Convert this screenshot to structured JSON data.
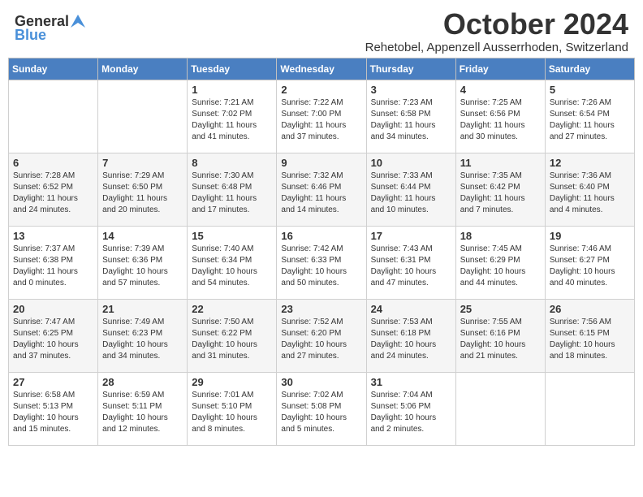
{
  "header": {
    "logo_general": "General",
    "logo_blue": "Blue",
    "month": "October 2024",
    "location": "Rehetobel, Appenzell Ausserrhoden, Switzerland"
  },
  "days_of_week": [
    "Sunday",
    "Monday",
    "Tuesday",
    "Wednesday",
    "Thursday",
    "Friday",
    "Saturday"
  ],
  "weeks": [
    [
      {
        "day": "",
        "sunrise": "",
        "sunset": "",
        "daylight": ""
      },
      {
        "day": "",
        "sunrise": "",
        "sunset": "",
        "daylight": ""
      },
      {
        "day": "1",
        "sunrise": "Sunrise: 7:21 AM",
        "sunset": "Sunset: 7:02 PM",
        "daylight": "Daylight: 11 hours and 41 minutes."
      },
      {
        "day": "2",
        "sunrise": "Sunrise: 7:22 AM",
        "sunset": "Sunset: 7:00 PM",
        "daylight": "Daylight: 11 hours and 37 minutes."
      },
      {
        "day": "3",
        "sunrise": "Sunrise: 7:23 AM",
        "sunset": "Sunset: 6:58 PM",
        "daylight": "Daylight: 11 hours and 34 minutes."
      },
      {
        "day": "4",
        "sunrise": "Sunrise: 7:25 AM",
        "sunset": "Sunset: 6:56 PM",
        "daylight": "Daylight: 11 hours and 30 minutes."
      },
      {
        "day": "5",
        "sunrise": "Sunrise: 7:26 AM",
        "sunset": "Sunset: 6:54 PM",
        "daylight": "Daylight: 11 hours and 27 minutes."
      }
    ],
    [
      {
        "day": "6",
        "sunrise": "Sunrise: 7:28 AM",
        "sunset": "Sunset: 6:52 PM",
        "daylight": "Daylight: 11 hours and 24 minutes."
      },
      {
        "day": "7",
        "sunrise": "Sunrise: 7:29 AM",
        "sunset": "Sunset: 6:50 PM",
        "daylight": "Daylight: 11 hours and 20 minutes."
      },
      {
        "day": "8",
        "sunrise": "Sunrise: 7:30 AM",
        "sunset": "Sunset: 6:48 PM",
        "daylight": "Daylight: 11 hours and 17 minutes."
      },
      {
        "day": "9",
        "sunrise": "Sunrise: 7:32 AM",
        "sunset": "Sunset: 6:46 PM",
        "daylight": "Daylight: 11 hours and 14 minutes."
      },
      {
        "day": "10",
        "sunrise": "Sunrise: 7:33 AM",
        "sunset": "Sunset: 6:44 PM",
        "daylight": "Daylight: 11 hours and 10 minutes."
      },
      {
        "day": "11",
        "sunrise": "Sunrise: 7:35 AM",
        "sunset": "Sunset: 6:42 PM",
        "daylight": "Daylight: 11 hours and 7 minutes."
      },
      {
        "day": "12",
        "sunrise": "Sunrise: 7:36 AM",
        "sunset": "Sunset: 6:40 PM",
        "daylight": "Daylight: 11 hours and 4 minutes."
      }
    ],
    [
      {
        "day": "13",
        "sunrise": "Sunrise: 7:37 AM",
        "sunset": "Sunset: 6:38 PM",
        "daylight": "Daylight: 11 hours and 0 minutes."
      },
      {
        "day": "14",
        "sunrise": "Sunrise: 7:39 AM",
        "sunset": "Sunset: 6:36 PM",
        "daylight": "Daylight: 10 hours and 57 minutes."
      },
      {
        "day": "15",
        "sunrise": "Sunrise: 7:40 AM",
        "sunset": "Sunset: 6:34 PM",
        "daylight": "Daylight: 10 hours and 54 minutes."
      },
      {
        "day": "16",
        "sunrise": "Sunrise: 7:42 AM",
        "sunset": "Sunset: 6:33 PM",
        "daylight": "Daylight: 10 hours and 50 minutes."
      },
      {
        "day": "17",
        "sunrise": "Sunrise: 7:43 AM",
        "sunset": "Sunset: 6:31 PM",
        "daylight": "Daylight: 10 hours and 47 minutes."
      },
      {
        "day": "18",
        "sunrise": "Sunrise: 7:45 AM",
        "sunset": "Sunset: 6:29 PM",
        "daylight": "Daylight: 10 hours and 44 minutes."
      },
      {
        "day": "19",
        "sunrise": "Sunrise: 7:46 AM",
        "sunset": "Sunset: 6:27 PM",
        "daylight": "Daylight: 10 hours and 40 minutes."
      }
    ],
    [
      {
        "day": "20",
        "sunrise": "Sunrise: 7:47 AM",
        "sunset": "Sunset: 6:25 PM",
        "daylight": "Daylight: 10 hours and 37 minutes."
      },
      {
        "day": "21",
        "sunrise": "Sunrise: 7:49 AM",
        "sunset": "Sunset: 6:23 PM",
        "daylight": "Daylight: 10 hours and 34 minutes."
      },
      {
        "day": "22",
        "sunrise": "Sunrise: 7:50 AM",
        "sunset": "Sunset: 6:22 PM",
        "daylight": "Daylight: 10 hours and 31 minutes."
      },
      {
        "day": "23",
        "sunrise": "Sunrise: 7:52 AM",
        "sunset": "Sunset: 6:20 PM",
        "daylight": "Daylight: 10 hours and 27 minutes."
      },
      {
        "day": "24",
        "sunrise": "Sunrise: 7:53 AM",
        "sunset": "Sunset: 6:18 PM",
        "daylight": "Daylight: 10 hours and 24 minutes."
      },
      {
        "day": "25",
        "sunrise": "Sunrise: 7:55 AM",
        "sunset": "Sunset: 6:16 PM",
        "daylight": "Daylight: 10 hours and 21 minutes."
      },
      {
        "day": "26",
        "sunrise": "Sunrise: 7:56 AM",
        "sunset": "Sunset: 6:15 PM",
        "daylight": "Daylight: 10 hours and 18 minutes."
      }
    ],
    [
      {
        "day": "27",
        "sunrise": "Sunrise: 6:58 AM",
        "sunset": "Sunset: 5:13 PM",
        "daylight": "Daylight: 10 hours and 15 minutes."
      },
      {
        "day": "28",
        "sunrise": "Sunrise: 6:59 AM",
        "sunset": "Sunset: 5:11 PM",
        "daylight": "Daylight: 10 hours and 12 minutes."
      },
      {
        "day": "29",
        "sunrise": "Sunrise: 7:01 AM",
        "sunset": "Sunset: 5:10 PM",
        "daylight": "Daylight: 10 hours and 8 minutes."
      },
      {
        "day": "30",
        "sunrise": "Sunrise: 7:02 AM",
        "sunset": "Sunset: 5:08 PM",
        "daylight": "Daylight: 10 hours and 5 minutes."
      },
      {
        "day": "31",
        "sunrise": "Sunrise: 7:04 AM",
        "sunset": "Sunset: 5:06 PM",
        "daylight": "Daylight: 10 hours and 2 minutes."
      },
      {
        "day": "",
        "sunrise": "",
        "sunset": "",
        "daylight": ""
      },
      {
        "day": "",
        "sunrise": "",
        "sunset": "",
        "daylight": ""
      }
    ]
  ]
}
